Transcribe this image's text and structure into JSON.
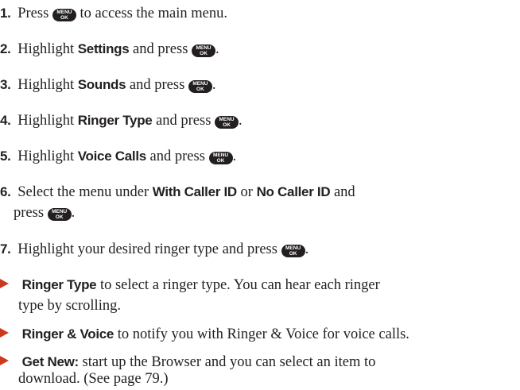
{
  "key": {
    "top": "MENU",
    "bottom": "OK"
  },
  "steps": [
    {
      "num": "1.",
      "t1": "Press",
      "t2": "to access the main menu."
    },
    {
      "num": "2.",
      "t1": "Highlight",
      "bold": "Settings",
      "t2": "and press",
      "t3": "."
    },
    {
      "num": "3.",
      "t1": "Highlight",
      "bold": "Sounds",
      "t2": "and press",
      "t3": "."
    },
    {
      "num": "4.",
      "t1": "Highlight",
      "bold": "Ringer Type",
      "t2": "and press",
      "t3": "."
    },
    {
      "num": "5.",
      "t1": "Highlight",
      "bold": "Voice Calls",
      "t2": "and press",
      "t3": "."
    },
    {
      "num": "6.",
      "t1": "Select the menu under",
      "bold1": "With Caller ID",
      "t2": "or",
      "bold2": "No Caller ID",
      "t3": "and",
      "t4": "press",
      "t5": "."
    },
    {
      "num": "7.",
      "t1": "Highlight your desired ringer type and press",
      "t2": "."
    }
  ],
  "bullets": [
    {
      "bold": "Ringer Type",
      "t1": "to select a ringer type. You can hear each ringer",
      "t2": "type by scrolling."
    },
    {
      "bold": "Ringer & Voice",
      "t1": "to notify you with Ringer & Voice for voice calls."
    },
    {
      "bold": "Get New:",
      "t1": "start up the Browser and you can select an item to",
      "t2": "download. (See page 79.)"
    }
  ]
}
